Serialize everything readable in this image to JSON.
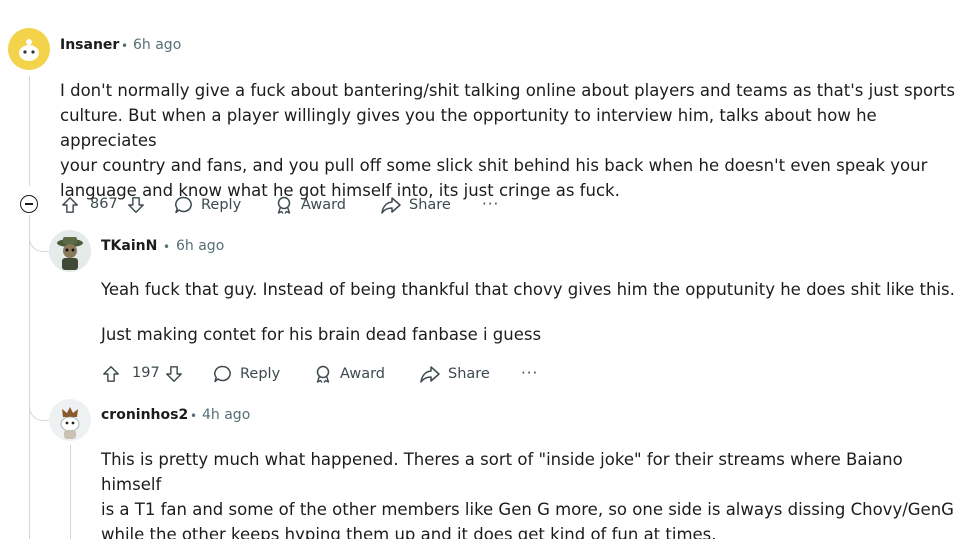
{
  "comments": [
    {
      "username": "Insaner",
      "time": "6h ago",
      "lines": [
        "I don't normally give a fuck about bantering/shit talking online about players and teams as that's just sports",
        "culture. But when a player willingly gives you the opportunity to interview him, talks about how he appreciates",
        "your country and fans, and you pull off some slick shit behind his back when he doesn't even speak your",
        "language and know what he got himself into, its just cringe as fuck."
      ],
      "votes": "867"
    },
    {
      "username": "TKainN",
      "time": "6h ago",
      "lines": [
        "Yeah fuck that guy. Instead of being thankful that chovy gives him the opputunity he does shit like this.",
        "Just making contet for his brain dead fanbase i guess"
      ],
      "votes": "197"
    },
    {
      "username": "croninhos2",
      "time": "4h ago",
      "lines": [
        "This is pretty much what happened. Theres a sort of \"inside joke\" for their streams where Baiano himself",
        "is a T1 fan and some of the other members like Gen G more, so one side is always dissing Chovy/GenG",
        "while the other keeps hyping them up and it does get kind of fun at times."
      ]
    }
  ],
  "actions": {
    "reply": "Reply",
    "award": "Award",
    "share": "Share",
    "more": "···",
    "separator": "•"
  },
  "icons": [
    "collapse-icon",
    "upvote-icon",
    "downvote-icon",
    "reply-icon",
    "award-icon",
    "share-icon",
    "more-icon"
  ]
}
